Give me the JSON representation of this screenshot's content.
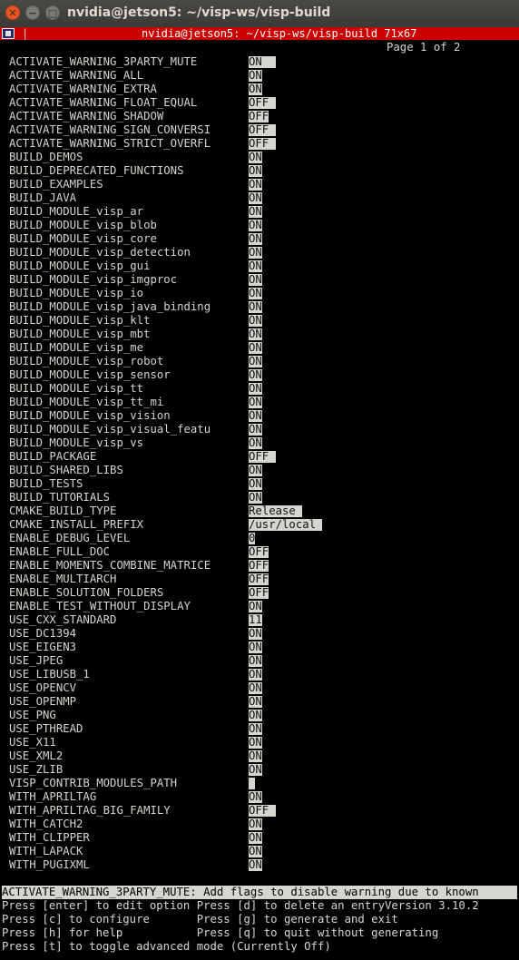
{
  "window": {
    "title": "nvidia@jetson5: ~/visp-ws/visp-build",
    "close_glyph": "✕",
    "min_glyph": "−",
    "max_glyph": "□"
  },
  "statusbar": {
    "separator": "|",
    "text": "nvidia@jetson5: ~/visp-ws/visp-build 71x67"
  },
  "terminal": {
    "page_indicator": "Page 1 of 2",
    "options": [
      {
        "name": "ACTIVATE_WARNING_3PARTY_MUTE",
        "value": "ON  "
      },
      {
        "name": "ACTIVATE_WARNING_ALL",
        "value": "ON"
      },
      {
        "name": "ACTIVATE_WARNING_EXTRA",
        "value": "ON"
      },
      {
        "name": "ACTIVATE_WARNING_FLOAT_EQUAL",
        "value": "OFF "
      },
      {
        "name": "ACTIVATE_WARNING_SHADOW",
        "value": "OFF"
      },
      {
        "name": "ACTIVATE_WARNING_SIGN_CONVERSI",
        "value": "OFF "
      },
      {
        "name": "ACTIVATE_WARNING_STRICT_OVERFL",
        "value": "OFF "
      },
      {
        "name": "BUILD_DEMOS",
        "value": "ON"
      },
      {
        "name": "BUILD_DEPRECATED_FUNCTIONS",
        "value": "ON"
      },
      {
        "name": "BUILD_EXAMPLES",
        "value": "ON"
      },
      {
        "name": "BUILD_JAVA",
        "value": "ON"
      },
      {
        "name": "BUILD_MODULE_visp_ar",
        "value": "ON"
      },
      {
        "name": "BUILD_MODULE_visp_blob",
        "value": "ON"
      },
      {
        "name": "BUILD_MODULE_visp_core",
        "value": "ON"
      },
      {
        "name": "BUILD_MODULE_visp_detection",
        "value": "ON"
      },
      {
        "name": "BUILD_MODULE_visp_gui",
        "value": "ON"
      },
      {
        "name": "BUILD_MODULE_visp_imgproc",
        "value": "ON"
      },
      {
        "name": "BUILD_MODULE_visp_io",
        "value": "ON"
      },
      {
        "name": "BUILD_MODULE_visp_java_binding",
        "value": "ON"
      },
      {
        "name": "BUILD_MODULE_visp_klt",
        "value": "ON"
      },
      {
        "name": "BUILD_MODULE_visp_mbt",
        "value": "ON"
      },
      {
        "name": "BUILD_MODULE_visp_me",
        "value": "ON"
      },
      {
        "name": "BUILD_MODULE_visp_robot",
        "value": "ON"
      },
      {
        "name": "BUILD_MODULE_visp_sensor",
        "value": "ON"
      },
      {
        "name": "BUILD_MODULE_visp_tt",
        "value": "ON"
      },
      {
        "name": "BUILD_MODULE_visp_tt_mi",
        "value": "ON"
      },
      {
        "name": "BUILD_MODULE_visp_vision",
        "value": "ON"
      },
      {
        "name": "BUILD_MODULE_visp_visual_featu",
        "value": "ON"
      },
      {
        "name": "BUILD_MODULE_visp_vs",
        "value": "ON"
      },
      {
        "name": "BUILD_PACKAGE",
        "value": "OFF "
      },
      {
        "name": "BUILD_SHARED_LIBS",
        "value": "ON"
      },
      {
        "name": "BUILD_TESTS",
        "value": "ON"
      },
      {
        "name": "BUILD_TUTORIALS",
        "value": "ON"
      },
      {
        "name": "CMAKE_BUILD_TYPE",
        "value": "Release "
      },
      {
        "name": "CMAKE_INSTALL_PREFIX",
        "value": "/usr/local "
      },
      {
        "name": "ENABLE_DEBUG_LEVEL",
        "value": "0"
      },
      {
        "name": "ENABLE_FULL_DOC",
        "value": "OFF"
      },
      {
        "name": "ENABLE_MOMENTS_COMBINE_MATRICE",
        "value": "OFF"
      },
      {
        "name": "ENABLE_MULTIARCH",
        "value": "OFF"
      },
      {
        "name": "ENABLE_SOLUTION_FOLDERS",
        "value": "OFF"
      },
      {
        "name": "ENABLE_TEST_WITHOUT_DISPLAY",
        "value": "ON"
      },
      {
        "name": "USE_CXX_STANDARD",
        "value": "11"
      },
      {
        "name": "USE_DC1394",
        "value": "ON"
      },
      {
        "name": "USE_EIGEN3",
        "value": "ON"
      },
      {
        "name": "USE_JPEG",
        "value": "ON"
      },
      {
        "name": "USE_LIBUSB_1",
        "value": "ON"
      },
      {
        "name": "USE_OPENCV",
        "value": "ON"
      },
      {
        "name": "USE_OPENMP",
        "value": "ON"
      },
      {
        "name": "USE_PNG",
        "value": "ON"
      },
      {
        "name": "USE_PTHREAD",
        "value": "ON"
      },
      {
        "name": "USE_X11",
        "value": "ON"
      },
      {
        "name": "USE_XML2",
        "value": "ON"
      },
      {
        "name": "USE_ZLIB",
        "value": "ON"
      },
      {
        "name": "VISP_CONTRIB_MODULES_PATH",
        "value": " "
      },
      {
        "name": "WITH_APRILTAG",
        "value": "ON"
      },
      {
        "name": "WITH_APRILTAG_BIG_FAMILY",
        "value": "OFF "
      },
      {
        "name": "WITH_CATCH2",
        "value": "ON"
      },
      {
        "name": "WITH_CLIPPER",
        "value": "ON"
      },
      {
        "name": "WITH_LAPACK",
        "value": "ON"
      },
      {
        "name": "WITH_PUGIXML",
        "value": "ON"
      }
    ],
    "help_line": "ACTIVATE_WARNING_3PARTY_MUTE: Add flags to disable warning due to known",
    "footer": [
      "Press [enter] to edit option Press [d] to delete an entryVersion 3.10.2",
      "Press [c] to configure       Press [g] to generate and exit",
      "Press [h] for help           Press [q] to quit without generating",
      "Press [t] to toggle advanced mode (Currently Off)"
    ]
  }
}
